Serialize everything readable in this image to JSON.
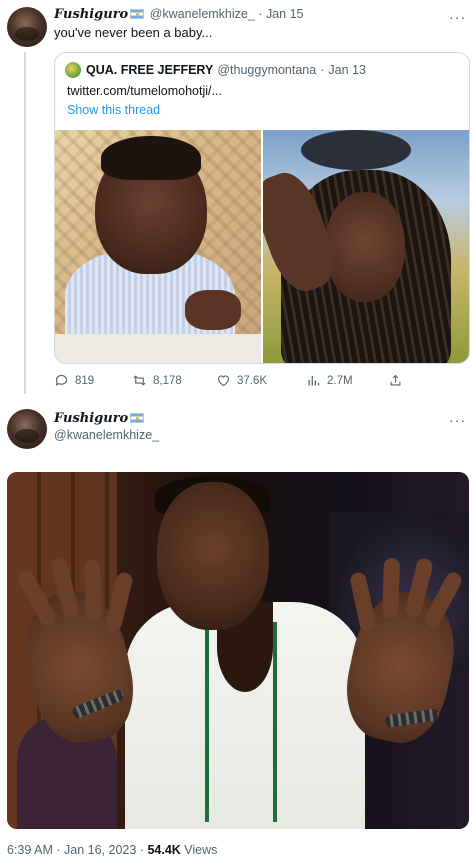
{
  "tweet1": {
    "author_name": "Fushiguro",
    "author_handle": "@kwanelemkhize_",
    "separator": "·",
    "date": "Jan 15",
    "text": "you've never been a baby...",
    "quote": {
      "author_name": "QUA. FREE JEFFERY",
      "author_handle": "@thuggymontana",
      "separator": "·",
      "date": "Jan 13",
      "link_text": "twitter.com/tumelomohotji/...",
      "show_thread": "Show this thread",
      "photos": [
        "baby-photo",
        "woman-selfie-photo"
      ]
    },
    "actions": {
      "replies": "819",
      "retweets": "8,178",
      "likes": "37.6K",
      "views": "2.7M"
    }
  },
  "tweet2": {
    "author_name": "Fushiguro",
    "author_handle": "@kwanelemkhize_",
    "more": "···",
    "photo": "man-raising-hands-photo"
  },
  "footer": {
    "time": "6:39 AM",
    "separator": "·",
    "date": "Jan 16, 2023",
    "separator2": "·",
    "views_count": "54.4K",
    "views_label": "Views"
  },
  "colors": {
    "text": "#0f1419",
    "muted": "#536471",
    "link": "#1d9bf0",
    "border": "#cfd9de"
  }
}
